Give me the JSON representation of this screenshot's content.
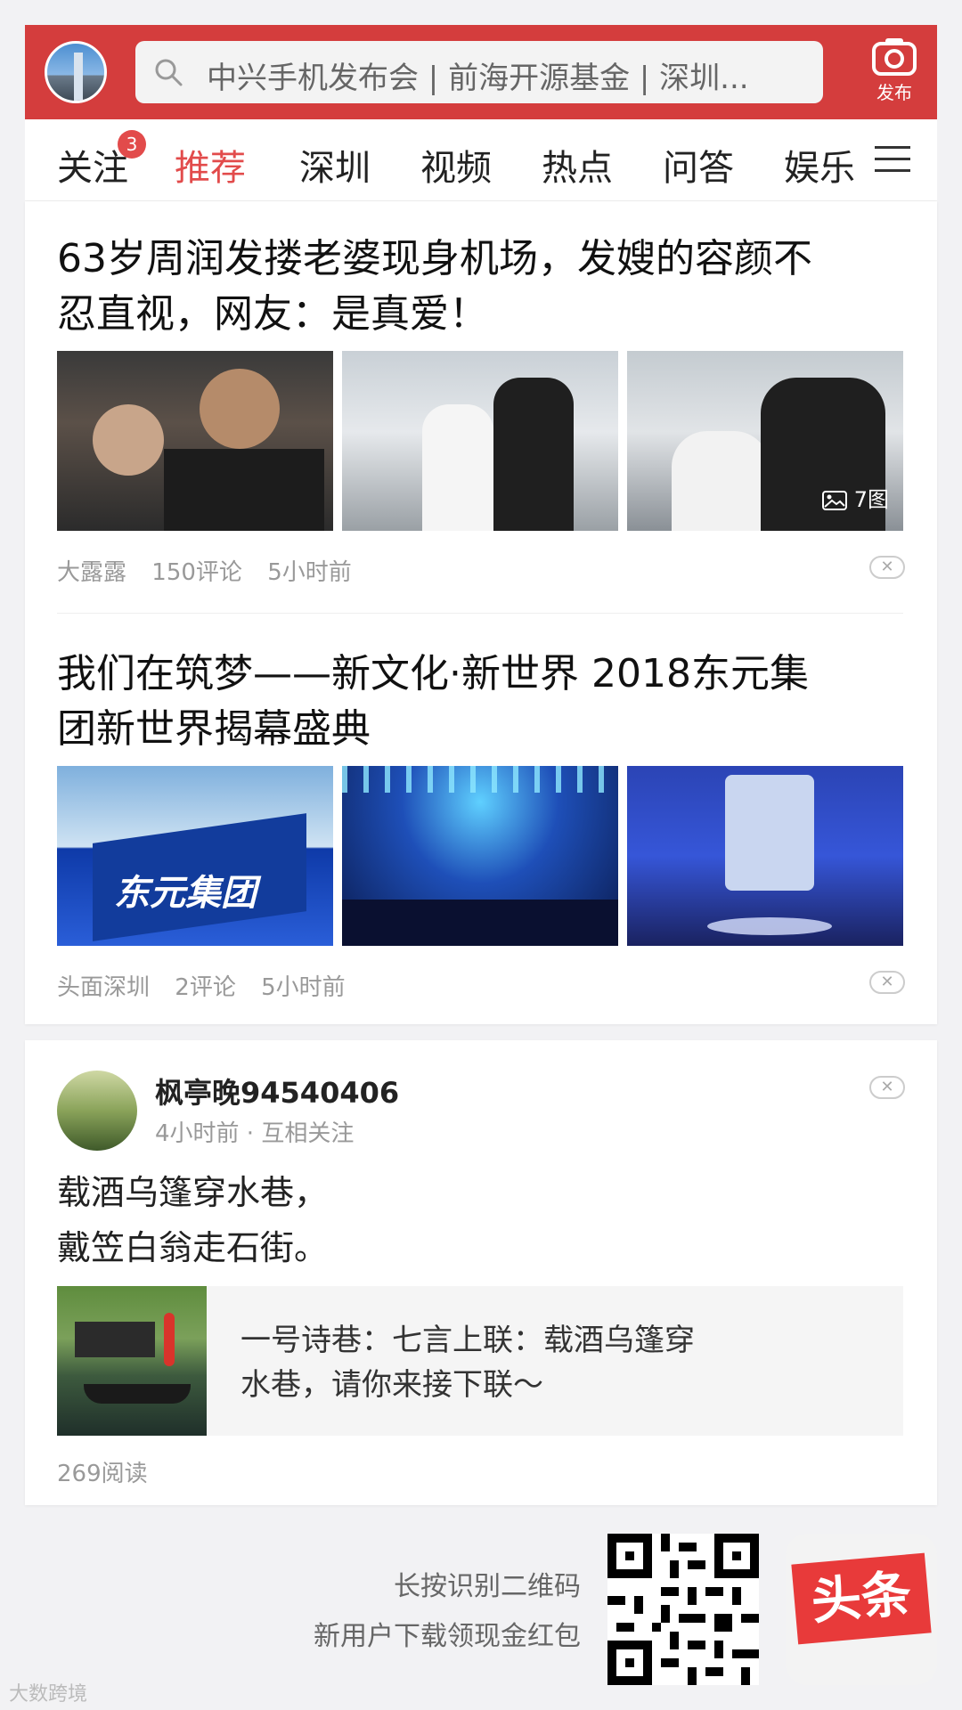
{
  "header": {
    "search_placeholder": "中兴手机发布会 | 前海开源基金 | 深圳...",
    "publish_label": "发布",
    "brand_color": "#d43d3d"
  },
  "tabs": [
    {
      "label": "关注",
      "badge": "3"
    },
    {
      "label": "推荐",
      "active": true
    },
    {
      "label": "深圳"
    },
    {
      "label": "视频"
    },
    {
      "label": "热点"
    },
    {
      "label": "问答"
    },
    {
      "label": "娱乐"
    }
  ],
  "articles": [
    {
      "title_line1": "63岁周润发搂老婆现身机场，发嫂的容颜不",
      "title_line2": "忍直视，网友：是真爱！",
      "source": "大露露",
      "comments": "150评论",
      "time": "5小时前",
      "pic_count": "7图"
    },
    {
      "title_line1": "我们在筑梦——新文化·新世界 2018东元集",
      "title_line2": "团新世界揭幕盛典",
      "source": "头面深圳",
      "comments": "2评论",
      "time": "5小时前",
      "image_text": "东元集团"
    }
  ],
  "post": {
    "username": "枫亭晚94540406",
    "time": "4小时前",
    "relation": "互相关注",
    "line1": "载酒乌篷穿水巷，",
    "line2": "戴笠白翁走石街。",
    "link_line1": "一号诗巷：七言上联：载酒乌篷穿",
    "link_line2": "水巷，请你来接下联～",
    "reads": "269阅读"
  },
  "footer": {
    "line1": "长按识别二维码",
    "line2": "新用户下载领现金红包",
    "logo_text": "头条",
    "watermark": "大数跨境"
  }
}
